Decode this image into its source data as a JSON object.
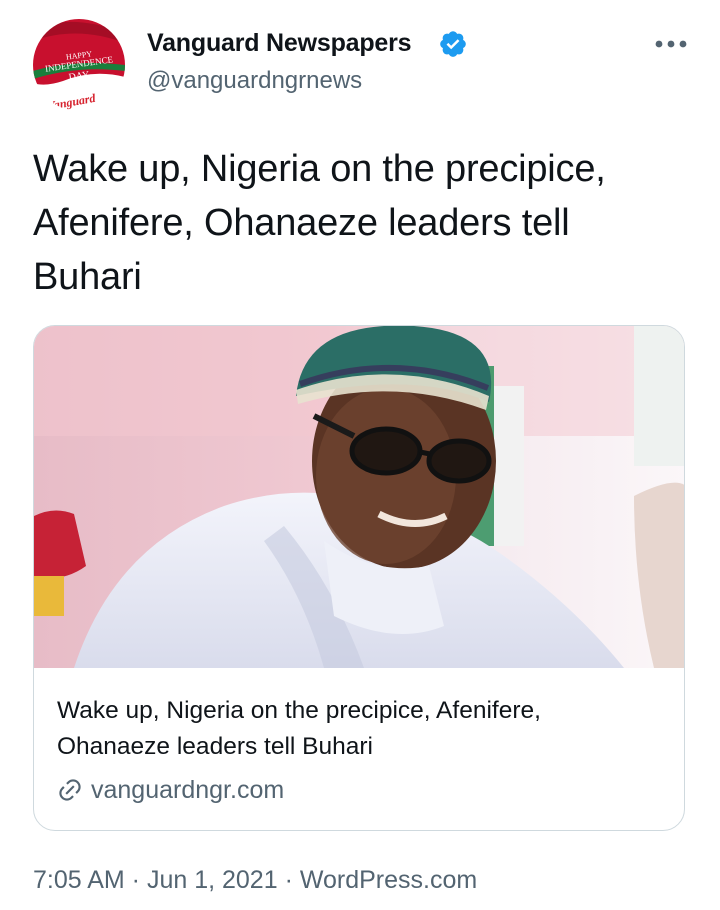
{
  "author": {
    "display_name": "Vanguard Newspapers",
    "handle": "@vanguardngrnews",
    "verified_icon": "verified-badge-icon",
    "avatar": {
      "line1": "HAPPY",
      "line2": "INDEPENDENCE",
      "line3": "DAY",
      "line4": "FROM",
      "brand": "Vanguard"
    }
  },
  "more_icon": "more-horizontal-icon",
  "tweet": {
    "text": "Wake up, Nigeria on the precipice, Afenifere, Ohanaeze leaders tell Buhari"
  },
  "card": {
    "title": "Wake up, Nigeria on the precipice, Afenifere, Ohanaeze leaders tell Buhari",
    "domain": "vanguardngr.com",
    "link_icon": "link-icon"
  },
  "meta": {
    "time": "7:05 AM",
    "separator": " · ",
    "date": "Jun 1, 2021",
    "source": "WordPress.com"
  },
  "colors": {
    "text_primary": "#0f1419",
    "text_secondary": "#536471",
    "verified_blue": "#1d9bf0",
    "border": "#cfd9de",
    "brand_red": "#d6202c"
  }
}
